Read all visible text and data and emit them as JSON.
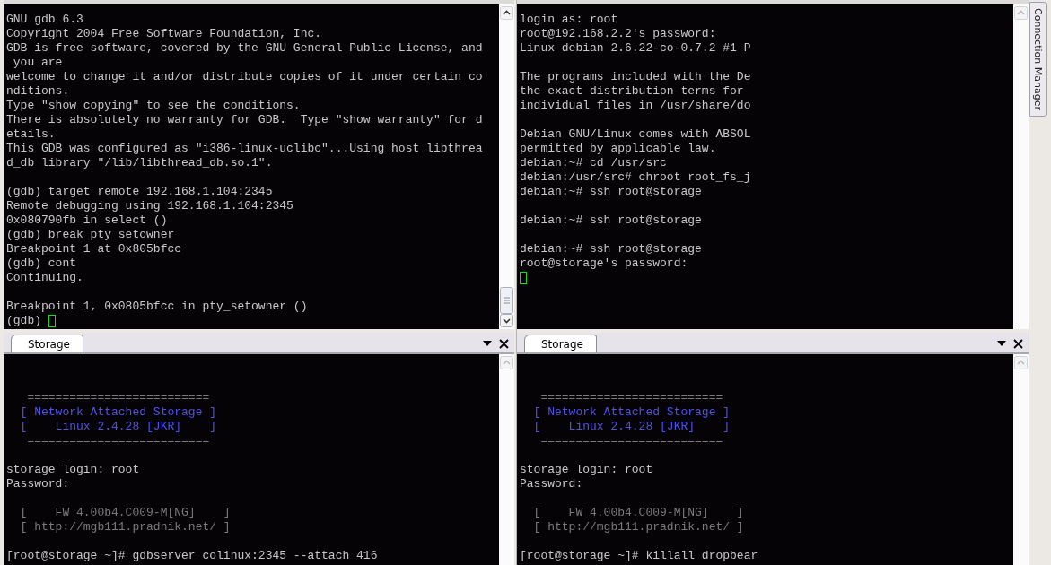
{
  "panes": [
    {
      "scrollable": true,
      "lines": [
        {
          "kind": "text",
          "text": "GNU gdb 6.3"
        },
        {
          "kind": "text",
          "text": "Copyright 2004 Free Software Foundation, Inc."
        },
        {
          "kind": "text",
          "text": "GDB is free software, covered by the GNU General Public License, and"
        },
        {
          "kind": "text",
          "text": " you are"
        },
        {
          "kind": "text",
          "text": "welcome to change it and/or distribute copies of it under certain co"
        },
        {
          "kind": "text",
          "text": "nditions."
        },
        {
          "kind": "text",
          "text": "Type \"show copying\" to see the conditions."
        },
        {
          "kind": "text",
          "text": "There is absolutely no warranty for GDB.  Type \"show warranty\" for d"
        },
        {
          "kind": "text",
          "text": "etails."
        },
        {
          "kind": "text",
          "text": "This GDB was configured as \"i386-linux-uclibc\"...Using host libthrea"
        },
        {
          "kind": "text",
          "text": "d_db library \"/lib/libthread_db.so.1\"."
        },
        {
          "kind": "blank"
        },
        {
          "kind": "text",
          "text": "(gdb) target remote 192.168.1.104:2345"
        },
        {
          "kind": "text",
          "text": "Remote debugging using 192.168.1.104:2345"
        },
        {
          "kind": "text",
          "text": "0x080790fb in select ()"
        },
        {
          "kind": "text",
          "text": "(gdb) break pty_setowner"
        },
        {
          "kind": "text",
          "text": "Breakpoint 1 at 0x805bfcc"
        },
        {
          "kind": "text",
          "text": "(gdb) cont"
        },
        {
          "kind": "text",
          "text": "Continuing."
        },
        {
          "kind": "blank"
        },
        {
          "kind": "text",
          "text": "Breakpoint 1, 0x0805bfcc in pty_setowner ()"
        },
        {
          "kind": "prompt",
          "text": "(gdb) "
        }
      ]
    },
    {
      "scrollable": false,
      "lines": [
        {
          "kind": "text",
          "text": "login as: root"
        },
        {
          "kind": "text",
          "text": "root@192.168.2.2's password:"
        },
        {
          "kind": "text",
          "text": "Linux debian 2.6.22-co-0.7.2 #1 P"
        },
        {
          "kind": "blank"
        },
        {
          "kind": "text",
          "text": "The programs included with the De"
        },
        {
          "kind": "text",
          "text": "the exact distribution terms for"
        },
        {
          "kind": "text",
          "text": "individual files in /usr/share/do"
        },
        {
          "kind": "blank"
        },
        {
          "kind": "text",
          "text": "Debian GNU/Linux comes with ABSOL"
        },
        {
          "kind": "text",
          "text": "permitted by applicable law."
        },
        {
          "kind": "text",
          "text": "debian:~# cd /usr/src"
        },
        {
          "kind": "text",
          "text": "debian:/usr/src# chroot root_fs_j"
        },
        {
          "kind": "text",
          "text": "debian:~# ssh root@storage"
        },
        {
          "kind": "blank"
        },
        {
          "kind": "text",
          "text": "debian:~# ssh root@storage"
        },
        {
          "kind": "blank"
        },
        {
          "kind": "text",
          "text": "debian:~# ssh root@storage"
        },
        {
          "kind": "text",
          "text": "root@storage's password:"
        },
        {
          "kind": "prompt"
        }
      ]
    },
    {
      "tab": {
        "label": "Storage"
      },
      "scrollable": false,
      "lines": [
        {
          "kind": "blank"
        },
        {
          "kind": "blank"
        },
        {
          "kind": "dim",
          "text": "   =========================="
        },
        {
          "kind": "banner",
          "text": "  [ Network Attached Storage ]"
        },
        {
          "kind": "banner",
          "text": "  [    Linux 2.4.28 [JKR]    ]"
        },
        {
          "kind": "dim",
          "text": "   =========================="
        },
        {
          "kind": "blank"
        },
        {
          "kind": "text",
          "text": "storage login: root"
        },
        {
          "kind": "text",
          "text": "Password:"
        },
        {
          "kind": "blank"
        },
        {
          "kind": "dim",
          "text": "  [    FW 4.00b4.C009-M[NG]    ]"
        },
        {
          "kind": "dim",
          "text": "  [ http://mgb111.pradnik.net/ ]"
        },
        {
          "kind": "blank"
        },
        {
          "kind": "text",
          "text": "[root@storage ~]# gdbserver colinux:2345 --attach 416"
        }
      ]
    },
    {
      "tab": {
        "label": "Storage"
      },
      "scrollable": false,
      "lines": [
        {
          "kind": "blank"
        },
        {
          "kind": "blank"
        },
        {
          "kind": "dim",
          "text": "   =========================="
        },
        {
          "kind": "banner",
          "text": "  [ Network Attached Storage ]"
        },
        {
          "kind": "banner",
          "text": "  [    Linux 2.4.28 [JKR]    ]"
        },
        {
          "kind": "dim",
          "text": "   =========================="
        },
        {
          "kind": "blank"
        },
        {
          "kind": "text",
          "text": "storage login: root"
        },
        {
          "kind": "text",
          "text": "Password:"
        },
        {
          "kind": "blank"
        },
        {
          "kind": "dim",
          "text": "  [    FW 4.00b4.C009-M[NG]    ]"
        },
        {
          "kind": "dim",
          "text": "  [ http://mgb111.pradnik.net/ ]"
        },
        {
          "kind": "blank"
        },
        {
          "kind": "text",
          "text": "[root@storage ~]# killall dropbear"
        }
      ]
    }
  ],
  "side_tab": {
    "label": "Connection Manager"
  }
}
